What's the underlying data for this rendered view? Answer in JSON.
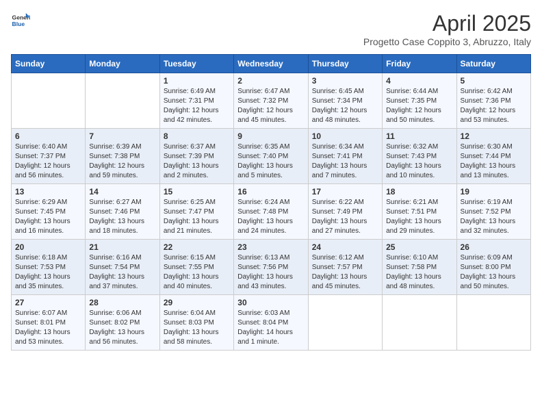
{
  "logo": {
    "line1": "General",
    "line2": "Blue"
  },
  "title": "April 2025",
  "subtitle": "Progetto Case Coppito 3, Abruzzo, Italy",
  "days_of_week": [
    "Sunday",
    "Monday",
    "Tuesday",
    "Wednesday",
    "Thursday",
    "Friday",
    "Saturday"
  ],
  "weeks": [
    [
      {
        "day": "",
        "info": ""
      },
      {
        "day": "",
        "info": ""
      },
      {
        "day": "1",
        "info": "Sunrise: 6:49 AM\nSunset: 7:31 PM\nDaylight: 12 hours and 42 minutes."
      },
      {
        "day": "2",
        "info": "Sunrise: 6:47 AM\nSunset: 7:32 PM\nDaylight: 12 hours and 45 minutes."
      },
      {
        "day": "3",
        "info": "Sunrise: 6:45 AM\nSunset: 7:34 PM\nDaylight: 12 hours and 48 minutes."
      },
      {
        "day": "4",
        "info": "Sunrise: 6:44 AM\nSunset: 7:35 PM\nDaylight: 12 hours and 50 minutes."
      },
      {
        "day": "5",
        "info": "Sunrise: 6:42 AM\nSunset: 7:36 PM\nDaylight: 12 hours and 53 minutes."
      }
    ],
    [
      {
        "day": "6",
        "info": "Sunrise: 6:40 AM\nSunset: 7:37 PM\nDaylight: 12 hours and 56 minutes."
      },
      {
        "day": "7",
        "info": "Sunrise: 6:39 AM\nSunset: 7:38 PM\nDaylight: 12 hours and 59 minutes."
      },
      {
        "day": "8",
        "info": "Sunrise: 6:37 AM\nSunset: 7:39 PM\nDaylight: 13 hours and 2 minutes."
      },
      {
        "day": "9",
        "info": "Sunrise: 6:35 AM\nSunset: 7:40 PM\nDaylight: 13 hours and 5 minutes."
      },
      {
        "day": "10",
        "info": "Sunrise: 6:34 AM\nSunset: 7:41 PM\nDaylight: 13 hours and 7 minutes."
      },
      {
        "day": "11",
        "info": "Sunrise: 6:32 AM\nSunset: 7:43 PM\nDaylight: 13 hours and 10 minutes."
      },
      {
        "day": "12",
        "info": "Sunrise: 6:30 AM\nSunset: 7:44 PM\nDaylight: 13 hours and 13 minutes."
      }
    ],
    [
      {
        "day": "13",
        "info": "Sunrise: 6:29 AM\nSunset: 7:45 PM\nDaylight: 13 hours and 16 minutes."
      },
      {
        "day": "14",
        "info": "Sunrise: 6:27 AM\nSunset: 7:46 PM\nDaylight: 13 hours and 18 minutes."
      },
      {
        "day": "15",
        "info": "Sunrise: 6:25 AM\nSunset: 7:47 PM\nDaylight: 13 hours and 21 minutes."
      },
      {
        "day": "16",
        "info": "Sunrise: 6:24 AM\nSunset: 7:48 PM\nDaylight: 13 hours and 24 minutes."
      },
      {
        "day": "17",
        "info": "Sunrise: 6:22 AM\nSunset: 7:49 PM\nDaylight: 13 hours and 27 minutes."
      },
      {
        "day": "18",
        "info": "Sunrise: 6:21 AM\nSunset: 7:51 PM\nDaylight: 13 hours and 29 minutes."
      },
      {
        "day": "19",
        "info": "Sunrise: 6:19 AM\nSunset: 7:52 PM\nDaylight: 13 hours and 32 minutes."
      }
    ],
    [
      {
        "day": "20",
        "info": "Sunrise: 6:18 AM\nSunset: 7:53 PM\nDaylight: 13 hours and 35 minutes."
      },
      {
        "day": "21",
        "info": "Sunrise: 6:16 AM\nSunset: 7:54 PM\nDaylight: 13 hours and 37 minutes."
      },
      {
        "day": "22",
        "info": "Sunrise: 6:15 AM\nSunset: 7:55 PM\nDaylight: 13 hours and 40 minutes."
      },
      {
        "day": "23",
        "info": "Sunrise: 6:13 AM\nSunset: 7:56 PM\nDaylight: 13 hours and 43 minutes."
      },
      {
        "day": "24",
        "info": "Sunrise: 6:12 AM\nSunset: 7:57 PM\nDaylight: 13 hours and 45 minutes."
      },
      {
        "day": "25",
        "info": "Sunrise: 6:10 AM\nSunset: 7:58 PM\nDaylight: 13 hours and 48 minutes."
      },
      {
        "day": "26",
        "info": "Sunrise: 6:09 AM\nSunset: 8:00 PM\nDaylight: 13 hours and 50 minutes."
      }
    ],
    [
      {
        "day": "27",
        "info": "Sunrise: 6:07 AM\nSunset: 8:01 PM\nDaylight: 13 hours and 53 minutes."
      },
      {
        "day": "28",
        "info": "Sunrise: 6:06 AM\nSunset: 8:02 PM\nDaylight: 13 hours and 56 minutes."
      },
      {
        "day": "29",
        "info": "Sunrise: 6:04 AM\nSunset: 8:03 PM\nDaylight: 13 hours and 58 minutes."
      },
      {
        "day": "30",
        "info": "Sunrise: 6:03 AM\nSunset: 8:04 PM\nDaylight: 14 hours and 1 minute."
      },
      {
        "day": "",
        "info": ""
      },
      {
        "day": "",
        "info": ""
      },
      {
        "day": "",
        "info": ""
      }
    ]
  ]
}
